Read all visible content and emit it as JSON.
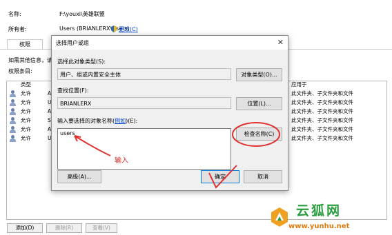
{
  "background": {
    "name_label": "名称:",
    "name_value": "F:\\youxi\\英雄联盟",
    "owner_label": "所有者:",
    "owner_value": "Users (BRIANLERX\\Users)",
    "owner_change_link": "更改(C)",
    "tabs": [
      "权限"
    ],
    "info_text": "如需其他信息，请",
    "entries_label": "权限条目:",
    "col_type": "类型",
    "col_apply": "应用于",
    "rows": [
      {
        "type": "允许",
        "first": "A",
        "apply": "此文件夹、子文件夹和文件"
      },
      {
        "type": "允许",
        "first": "U",
        "apply": "此文件夹、子文件夹和文件"
      },
      {
        "type": "允许",
        "first": "A",
        "apply": "此文件夹、子文件夹和文件"
      },
      {
        "type": "允许",
        "first": "S",
        "apply": "此文件夹、子文件夹和文件"
      },
      {
        "type": "允许",
        "first": "A",
        "apply": "此文件夹、子文件夹和文件"
      },
      {
        "type": "允许",
        "first": "U",
        "apply": "此文件夹、子文件夹和文件"
      }
    ],
    "buttons": {
      "add": "添加(D)",
      "remove": "删除(R)",
      "view": "查看(V)"
    }
  },
  "dialog": {
    "title": "选择用户或组",
    "object_type_label": "选择此对象类型(S):",
    "object_type_value": "用户、组或内置安全主体",
    "object_type_button": "对象类型(O)...",
    "location_label": "查找位置(F):",
    "location_value": "BRIANLERX",
    "location_button": "位置(L)...",
    "names_label_prefix": "输入要选择的对象名称(",
    "names_label_link": "例如",
    "names_label_suffix": ")(E):",
    "names_value": "users",
    "check_names_button": "检查名称(C)",
    "advanced_button": "高级(A)...",
    "ok_button": "确定",
    "cancel_button": "取消"
  },
  "annotation": {
    "text": "输入",
    "color": "#e03030"
  },
  "watermark": {
    "text": "云狐网",
    "url": "www.yunhu.net"
  }
}
